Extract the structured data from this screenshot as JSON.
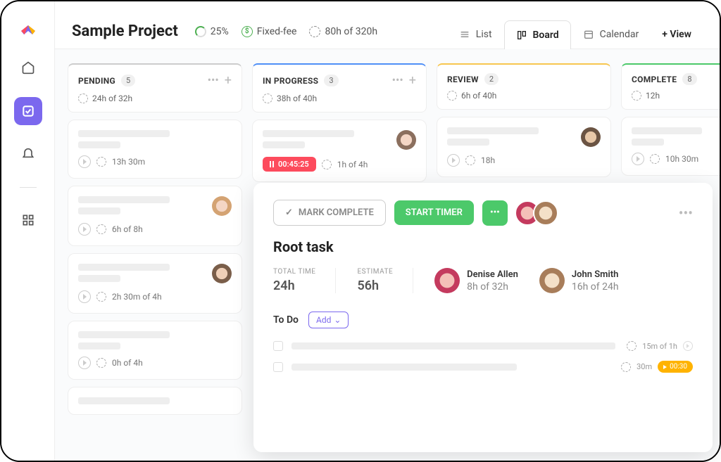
{
  "project": {
    "title": "Sample Project",
    "progress": "25%",
    "billing": "Fixed-fee",
    "hours": "80h of 320h"
  },
  "views": {
    "list": "List",
    "board": "Board",
    "calendar": "Calendar",
    "add": "+ View"
  },
  "columns": [
    {
      "name": "PENDING",
      "count": "5",
      "time": "24h of 32h",
      "color": "#ccc"
    },
    {
      "name": "IN PROGRESS",
      "count": "3",
      "time": "38h of 40h",
      "color": "#4f8ff7"
    },
    {
      "name": "REVIEW",
      "count": "2",
      "time": "6h of 40h",
      "color": "#f7c64f"
    },
    {
      "name": "COMPLETE",
      "count": "8",
      "time": "12h",
      "color": "#4cc96a"
    }
  ],
  "pending_cards": [
    {
      "time": "13h 30m"
    },
    {
      "time": "6h of 8h",
      "avatar": "a2"
    },
    {
      "time": "2h 30m of 4h",
      "avatar": "a4"
    },
    {
      "time": "0h of 4h"
    },
    {
      "time": ""
    }
  ],
  "inprogress_card": {
    "timer": "00:45:25",
    "estimate": "1h of 4h",
    "avatar": "a1"
  },
  "review_card": {
    "time": "18h",
    "avatar": "a3"
  },
  "complete_card": {
    "time": "10h 30m"
  },
  "task": {
    "mark_complete": "MARK COMPLETE",
    "start_timer": "START TIMER",
    "title": "Root task",
    "total_label": "TOTAL TIME",
    "total_value": "24h",
    "estimate_label": "ESTIMATE",
    "estimate_value": "56h",
    "users": [
      {
        "name": "Denise Allen",
        "hours": "8h of 32h"
      },
      {
        "name": "John Smith",
        "hours": "16h of 24h"
      }
    ],
    "todo_label": "To Do",
    "add_label": "Add",
    "todos": [
      {
        "right": "15m of 1h"
      },
      {
        "right": "30m",
        "timer": "00:30"
      }
    ]
  }
}
